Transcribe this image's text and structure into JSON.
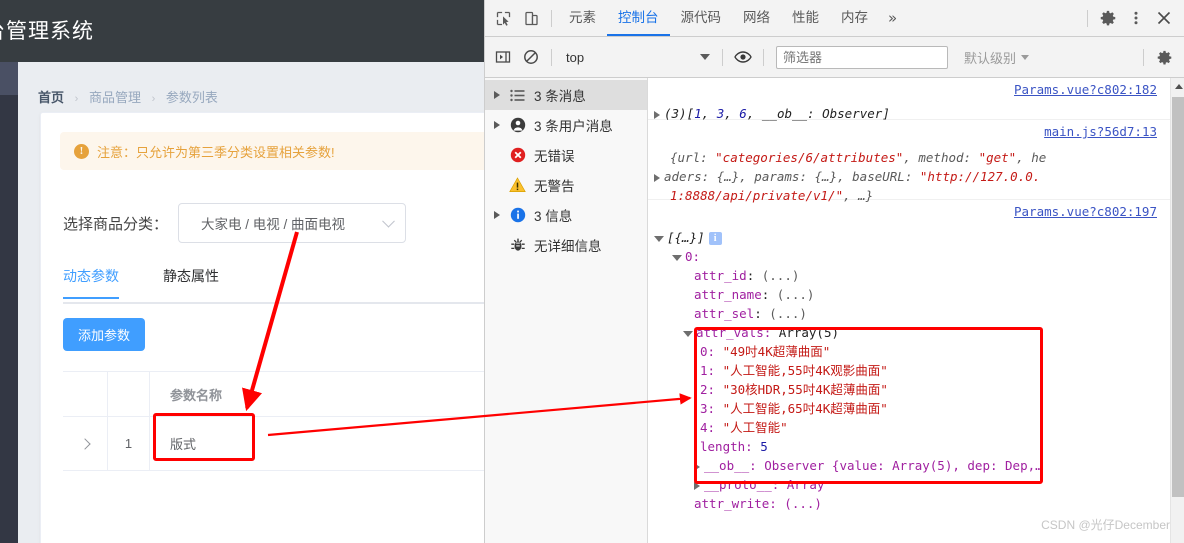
{
  "app": {
    "title": "台管理系统",
    "breadcrumb": {
      "home": "首页",
      "level2": "商品管理",
      "level3": "参数列表",
      "separator": "›"
    },
    "alert": {
      "icon": "exclamation-circle-icon",
      "text": "注意：只允许为第三季分类设置相关参数!"
    },
    "category": {
      "label": "选择商品分类：",
      "value": "大家电 / 电视 / 曲面电视",
      "chevron": "chevron-down-icon"
    },
    "tabs": [
      {
        "label": "动态参数",
        "active": true
      },
      {
        "label": "静态属性",
        "active": false
      }
    ],
    "add_button": "添加参数",
    "table": {
      "columns": [
        "",
        "",
        "参数名称"
      ],
      "header_name": "参数名称",
      "rows": [
        {
          "expand": "chevron-right-icon",
          "index": "1",
          "name": "版式"
        }
      ]
    }
  },
  "devtools": {
    "toolbar": {
      "inspect_icon": "inspect-element-icon",
      "device_icon": "device-toolbar-icon",
      "tabs": [
        {
          "label": "元素",
          "active": false
        },
        {
          "label": "控制台",
          "active": true
        },
        {
          "label": "源代码",
          "active": false
        },
        {
          "label": "网络",
          "active": false
        },
        {
          "label": "性能",
          "active": false
        },
        {
          "label": "内存",
          "active": false
        }
      ],
      "more": "»",
      "settings_icon": "gear-icon",
      "menu_icon": "kebab-menu-icon",
      "close_icon": "close-icon"
    },
    "filterbar": {
      "sidebar_toggle_icon": "console-sidebar-toggle-icon",
      "clear_icon": "clear-console-icon",
      "context": "top",
      "context_chevron": "chevron-down-icon",
      "eye_icon": "live-expression-icon",
      "filter_placeholder": "筛选器",
      "filter_value": "",
      "level": "默认级别",
      "level_chevron": "chevron-down-icon",
      "settings_icon": "gear-icon"
    },
    "message_sidebar": [
      {
        "icon": "list-icon",
        "label": "3 条消息",
        "has_triangle": true,
        "selected": true
      },
      {
        "icon": "user-icon",
        "label": "3 条用户消息",
        "has_triangle": true,
        "selected": false
      },
      {
        "icon": "error-icon",
        "label": "无错误",
        "has_triangle": false,
        "selected": false
      },
      {
        "icon": "warning-icon",
        "label": "无警告",
        "has_triangle": false,
        "selected": false
      },
      {
        "icon": "info-icon",
        "label": "3 信息",
        "has_triangle": true,
        "selected": false
      },
      {
        "icon": "verbose-bug-icon",
        "label": "无详细信息",
        "has_triangle": false,
        "selected": false
      }
    ],
    "console": {
      "entry1": {
        "source": "Params.vue?c802:182",
        "count": "(3)",
        "open_bracket": "[",
        "v1": "1",
        "v2": "3",
        "v3": "6",
        "ob_key": "__ob__: Observer",
        "close_bracket": "]"
      },
      "entry2": {
        "source": "main.js?56d7:13",
        "line1_pre": "{url: ",
        "line1_url": "\"categories/6/attributes\"",
        "line1_mid": ", method: ",
        "line1_method": "\"get\"",
        "line1_post": ", he",
        "line2_pre": "aders: {…}, params: {…}, baseURL: ",
        "line2_base": "\"http://127.0.0.",
        "line3_base": "1:8888/api/private/v1/\"",
        "line3_post": ", …}"
      },
      "entry3": {
        "source": "Params.vue?c802:197",
        "root": "[{…}]",
        "index0": "0:",
        "props": [
          {
            "key": "attr_id",
            "value": "(...)"
          },
          {
            "key": "attr_name",
            "value": "(...)"
          },
          {
            "key": "attr_sel",
            "value": "(...)"
          }
        ],
        "attr_vals_label": "attr_vals:",
        "attr_vals_type": "Array(5)",
        "attr_vals_items": [
          {
            "index": "0:",
            "value": "\"49吋4K超薄曲面\""
          },
          {
            "index": "1:",
            "value": "\"人工智能,55吋4K观影曲面\""
          },
          {
            "index": "2:",
            "value": "\"30核HDR,55吋4K超薄曲面\""
          },
          {
            "index": "3:",
            "value": "\"人工智能,65吋4K超薄曲面\""
          },
          {
            "index": "4:",
            "value": "\"人工智能\""
          }
        ],
        "length_key": "length:",
        "length_value": "5",
        "ob_line": "__ob__: Observer {value: Array(5), dep: Dep,…",
        "proto_line": "__proto__: Array",
        "attr_write": "attr_write: (...)"
      }
    }
  },
  "annotations": {
    "highlight_color": "#ff0000",
    "box_param_name": true,
    "box_attr_vals": true,
    "arrow_category_to_param": true,
    "arrow_param_to_console": true
  },
  "watermark": "CSDN @光仔December"
}
